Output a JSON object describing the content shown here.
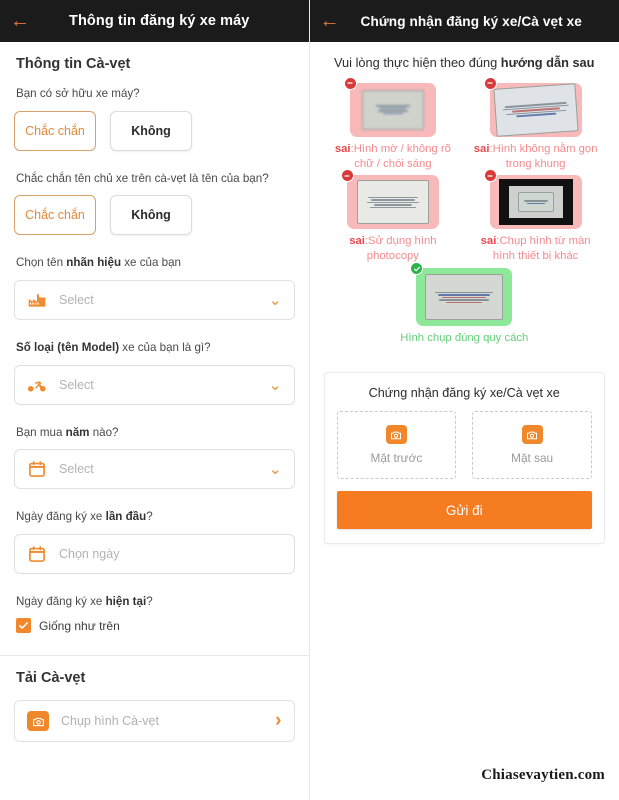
{
  "left": {
    "appbar": {
      "back_icon": "arrow-left-icon",
      "title": "Thông tin đăng ký xe máy"
    },
    "section_title": "Thông tin Cà-vẹt",
    "questions": [
      {
        "label": "Bạn có sở hữu xe máy?",
        "options": [
          {
            "label": "Chắc chắn",
            "selected": true
          },
          {
            "label": "Không",
            "selected": false
          }
        ]
      },
      {
        "label": "Chắc chắn tên chủ xe trên cà-vẹt là tên của bạn?",
        "options": [
          {
            "label": "Chắc chắn",
            "selected": true
          },
          {
            "label": "Không",
            "selected": false
          }
        ]
      }
    ],
    "fields": [
      {
        "label_prefix": "Chọn tên ",
        "label_bold": "nhãn hiệu",
        "label_suffix": " xe của bạn",
        "icon": "factory-icon",
        "value": "",
        "placeholder": "Select",
        "chevron": "chevron-down-icon"
      },
      {
        "label_prefix": "",
        "label_bold": "Số loại (tên Model)",
        "label_suffix": " xe của bạn là gì?",
        "icon": "motorcycle-icon",
        "value": "",
        "placeholder": "Select",
        "chevron": "chevron-down-icon"
      },
      {
        "label_prefix": "Bạn mua ",
        "label_bold": "năm",
        "label_suffix": " nào?",
        "icon": "calendar-icon",
        "value": "",
        "placeholder": "Select",
        "chevron": "chevron-down-icon"
      },
      {
        "label_prefix": "Ngày đăng ký xe ",
        "label_bold": "lần đầu",
        "label_suffix": "?",
        "icon": "calendar-icon",
        "value": "",
        "placeholder": "Chọn ngày",
        "chevron": ""
      }
    ],
    "current_reg": {
      "label_prefix": "Ngày đăng ký xe ",
      "label_bold": "hiện tại",
      "label_suffix": "?",
      "checkbox_label": "Giống như trên",
      "checkbox_checked": true,
      "checkbox_icon": "check-icon"
    },
    "upload_section": {
      "title": "Tải Cà-vẹt",
      "row_icon": "camera-icon",
      "row_label": "Chụp hình Cà-vẹt",
      "row_chevron": "chevron-right-icon"
    }
  },
  "right": {
    "appbar": {
      "back_icon": "arrow-left-icon",
      "title": "Chứng nhận đăng ký xe/Cà vẹt xe"
    },
    "guide_prefix": "Vui lòng thực hiện theo đúng ",
    "guide_bold": "hướng dẫn sau",
    "samples": [
      {
        "status": "bad",
        "badge_icon": "error-circle-icon",
        "tag": "sai",
        "caption": ":Hình mờ / không rõ chữ / chói sáng"
      },
      {
        "status": "bad",
        "badge_icon": "error-circle-icon",
        "tag": "sai",
        "caption": ":Hình không nằm gọn trong khung"
      },
      {
        "status": "bad",
        "badge_icon": "error-circle-icon",
        "tag": "sai",
        "caption": ":Sử dụng hình photocopy"
      },
      {
        "status": "bad",
        "badge_icon": "error-circle-icon",
        "tag": "sai",
        "caption": ":Chụp hình từ màn hình thiết bị khác"
      }
    ],
    "good_sample": {
      "status": "good",
      "badge_icon": "check-circle-icon",
      "caption": "Hình chụp đúng quy cách"
    },
    "upload_card": {
      "title": "Chứng nhận đăng ký xe/Cà vẹt xe",
      "dropzones": [
        {
          "icon": "camera-icon",
          "label": "Mặt trước"
        },
        {
          "icon": "camera-icon",
          "label": "Mặt sau"
        }
      ],
      "submit_label": "Gửi đi"
    },
    "watermark": "Chiasevaytien.com"
  },
  "colors": {
    "accent": "#f0872a",
    "submit": "#f57c20",
    "appbar": "#1b1b1b",
    "error": "#d83a3a",
    "success": "#2cb34a",
    "bad_bg": "#f8b9bb",
    "good_bg": "#8ee89a"
  }
}
